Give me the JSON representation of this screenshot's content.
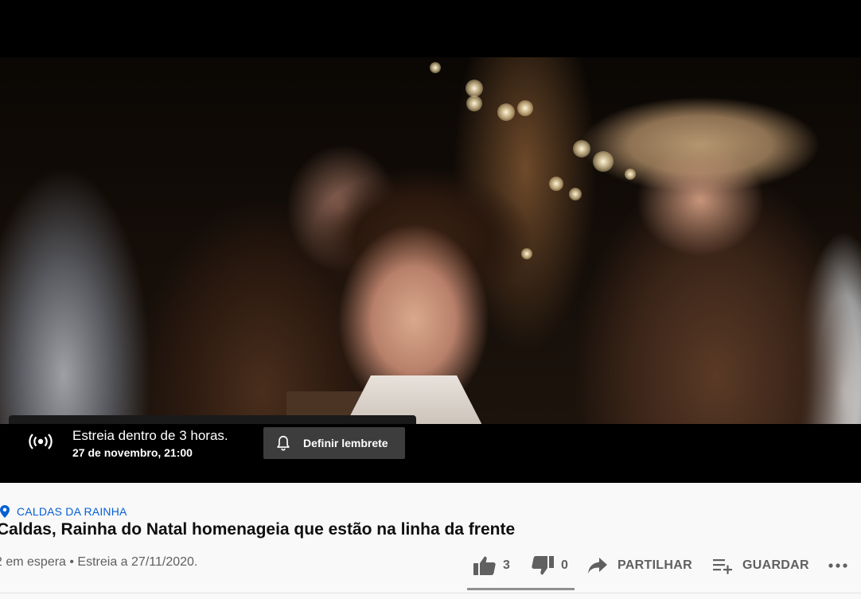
{
  "premiere": {
    "title": "Estreia dentro de 3 horas.",
    "date": "27 de novembro, 21:00",
    "remind_label": "Definir lembrete"
  },
  "video": {
    "location": "CALDAS DA RAINHA",
    "title": "Caldas, Rainha do Natal homenageia que estão na linha da frente",
    "meta": "2 em espera • Estreia a 27/11/2020."
  },
  "actions": {
    "likes": "3",
    "dislikes": "0",
    "share_label": "PARTILHAR",
    "save_label": "GUARDAR"
  },
  "icons": {
    "premiere": "live-broadcast-icon",
    "remind": "bell-icon",
    "location": "location-pin-icon",
    "like": "thumbs-up-icon",
    "dislike": "thumbs-down-icon",
    "share": "share-arrow-icon",
    "save": "playlist-add-icon",
    "more": "more-horizontal-icon"
  },
  "colors": {
    "link_blue": "#065fd4",
    "text_primary": "#0f0f0f",
    "text_secondary": "#606060",
    "remind_button_bg": "#3d3d3d"
  }
}
